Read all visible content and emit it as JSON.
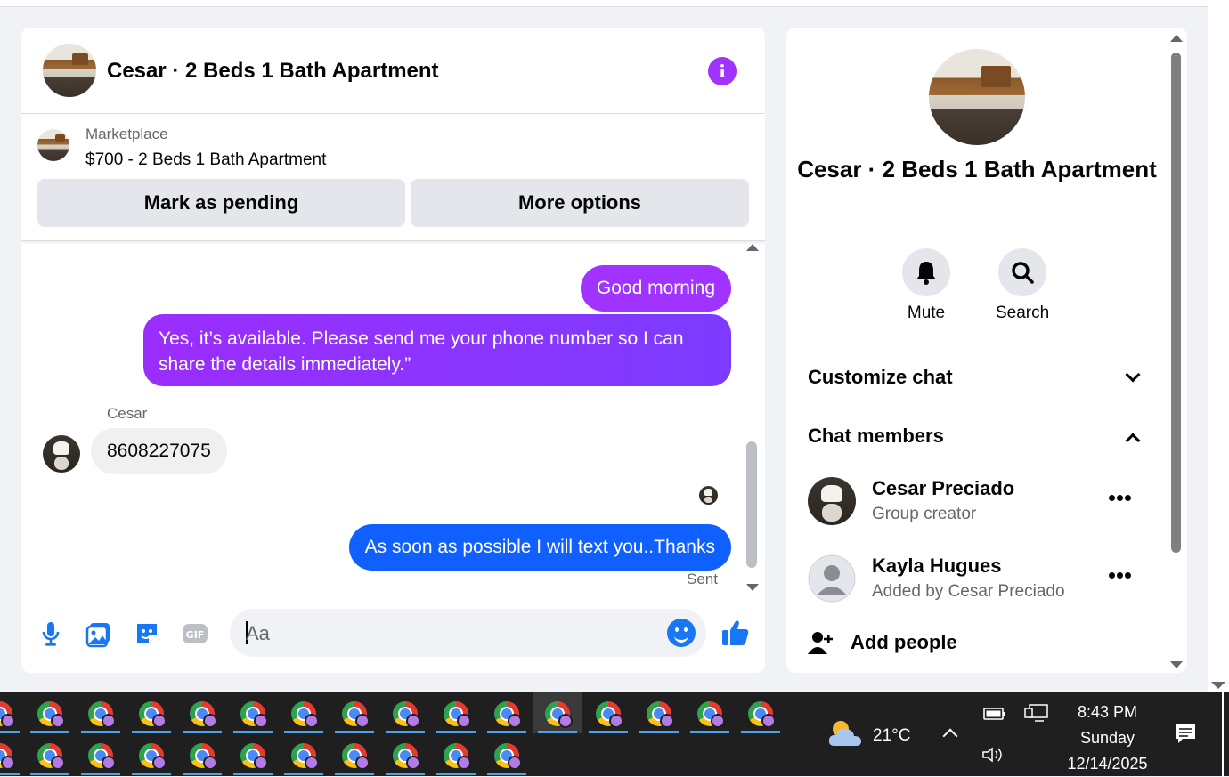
{
  "chat": {
    "title": "Cesar · 2 Beds 1 Bath Apartment",
    "marketplace_label": "Marketplace",
    "listing_title": "$700 - 2 Beds 1 Bath Apartment",
    "mark_pending_label": "Mark as pending",
    "more_options_label": "More options",
    "messages": [
      {
        "from": "me",
        "text": "Good morning"
      },
      {
        "from": "me",
        "text": "Yes, it’s available. Please send me your phone number so I can share the details immediately.”"
      },
      {
        "from": "Cesar",
        "sender_label": "Cesar",
        "text": "8608227075"
      },
      {
        "from": "me",
        "text": "As soon as possible I will text you..Thanks"
      }
    ],
    "status": "Sent",
    "input_placeholder": "Aa"
  },
  "info_panel": {
    "name": "Cesar · 2 Beds 1 Bath Apartment",
    "actions": [
      {
        "label": "Mute",
        "icon": "bell-icon"
      },
      {
        "label": "Search",
        "icon": "search-icon"
      }
    ],
    "customize_label": "Customize chat",
    "members_label": "Chat members",
    "members": [
      {
        "name": "Cesar Preciado",
        "role": "Group creator"
      },
      {
        "name": "Kayla Hugues",
        "role": "Added by Cesar Preciado"
      }
    ],
    "add_people_label": "Add people"
  },
  "taskbar": {
    "weather": "21°C",
    "time": "8:43 PM",
    "day": "Sunday",
    "date": "12/14/2025"
  },
  "colors": {
    "accent_purple": "#a033ff",
    "accent_blue": "#1060ff",
    "messenger_blue": "#1877f2"
  }
}
